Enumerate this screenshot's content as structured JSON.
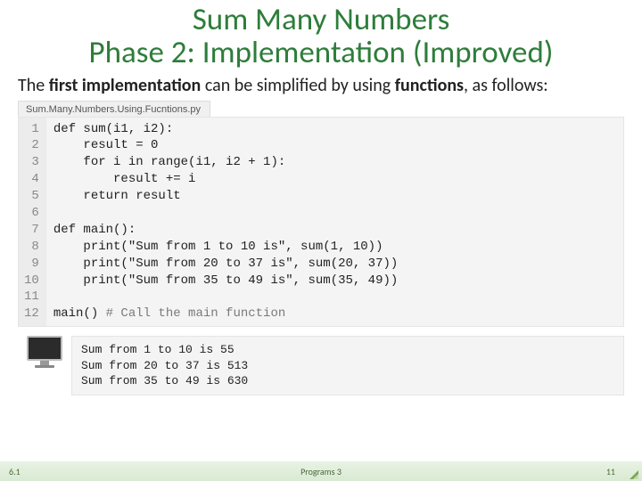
{
  "title": {
    "line1": "Sum Many Numbers",
    "line2": "Phase 2: Implementation (Improved)"
  },
  "intro": {
    "pre": "The ",
    "bold1": "first implementation",
    "mid": " can be simplified by using ",
    "bold2": "functions",
    "post": ", as follows:"
  },
  "file_tab": "Sum.Many.Numbers.Using.Fucntions.py",
  "code": {
    "gutter": "1\n2\n3\n4\n5\n6\n7\n8\n9\n10\n11\n12",
    "body": "def sum(i1, i2):\n    result = 0\n    for i in range(i1, i2 + 1):\n        result += i\n    return result\n\ndef main():\n    print(\"Sum from 1 to 10 is\", sum(1, 10))\n    print(\"Sum from 20 to 37 is\", sum(20, 37))\n    print(\"Sum from 35 to 49 is\", sum(35, 49))\n\nmain() ",
    "comment": "# Call the main function"
  },
  "output": "Sum from 1 to 10 is 55\nSum from 20 to 37 is 513\nSum from 35 to 49 is 630",
  "footer": {
    "left": "6.1",
    "center": "Programs 3",
    "right": "11"
  }
}
